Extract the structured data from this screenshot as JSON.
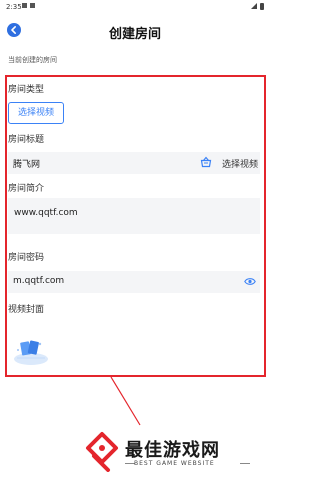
{
  "status_bar": {
    "time": "2:35"
  },
  "header": {
    "title": "创建房间"
  },
  "subtitle": "当前创建的房间",
  "form": {
    "room_type_label": "房间类型",
    "choose_video_button": "选择视频",
    "room_title_label": "房间标题",
    "room_title_value": "腾飞网",
    "room_title_action": "选择视频",
    "room_intro_label": "房间简介",
    "room_intro_value": "www.qqtf.com",
    "room_password_label": "房间密码",
    "room_password_value": "m.qqtf.com",
    "video_cover_label": "视频封面"
  },
  "watermark": {
    "title": "最佳游戏网",
    "subtitle": "BEST GAME WEBSITE"
  },
  "colors": {
    "accent_blue": "#3b82f6",
    "highlight_red": "#e4252c"
  },
  "icons": {
    "back": "back-arrow-icon",
    "basket": "basket-icon",
    "eye": "eye-icon"
  }
}
